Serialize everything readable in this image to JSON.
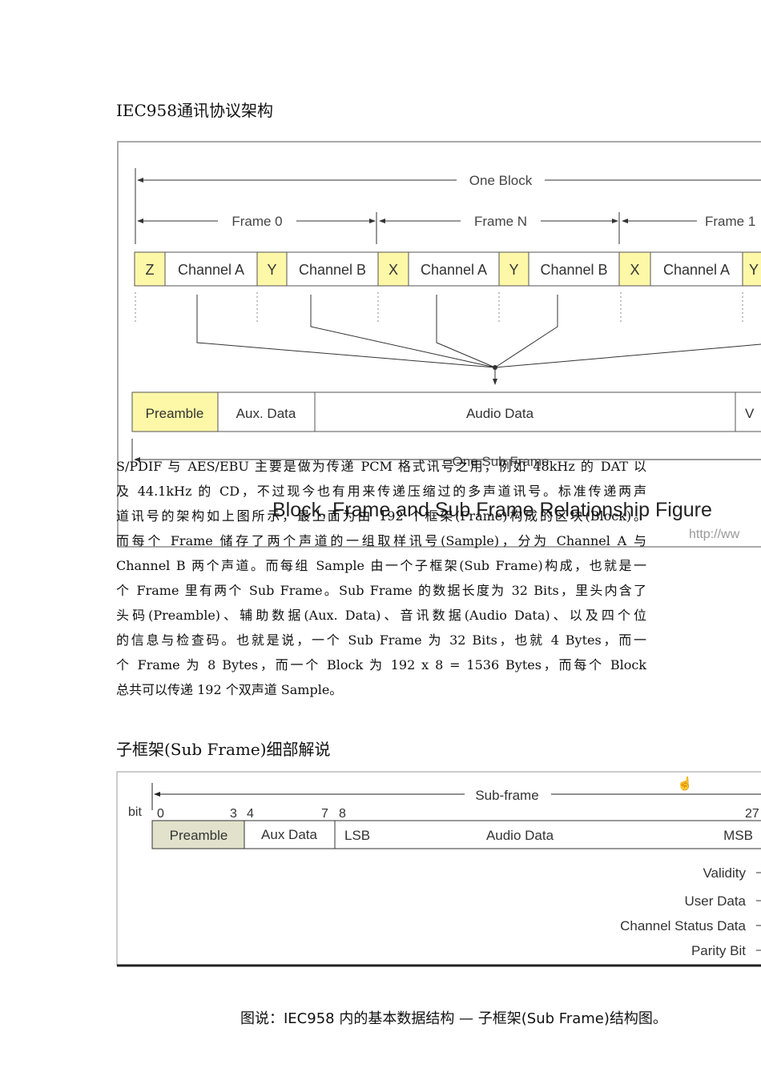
{
  "section1": {
    "heading": "IEC958通讯协议架构"
  },
  "figure1": {
    "one_block": "One Block",
    "frame_labels": [
      "Frame 0",
      "Frame N",
      "Frame 1"
    ],
    "cells": [
      "Z",
      "Channel A",
      "Y",
      "Channel B",
      "X",
      "Channel A",
      "Y",
      "Channel B",
      "X",
      "Channel A",
      "Y"
    ],
    "subframe_fields": [
      "Preamble",
      "Aux. Data",
      "Audio Data",
      "V"
    ],
    "one_sub_frame": "One Sub Frame",
    "title": "Block, Frame and Sub Frame Relationship Figure",
    "url": "http://ww",
    "highlight_color": "#fdf8a8"
  },
  "paragraph": {
    "lines": [
      "S/PDIF 与 AES/EBU 主要是做为传递 PCM 格式讯号之用，例如 48kHz 的 DAT 以",
      "及 44.1kHz 的 CD，不过现今也有用来传递压缩过的多声道讯号。标准传递两声",
      "道讯号的架构如上图所示，最上面为由 192 个框架(Frame)构成的区块(Block)。",
      "而每个 Frame 储存了两个声道的一组取样讯号(Sample)，分为 Channel A 与",
      "Channel B 两个声道。而每组 Sample 由一个子框架(Sub Frame)构成，也就是一",
      "个 Frame 里有两个 Sub Frame。Sub Frame 的数据长度为 32 Bits，里头内含了",
      "头码(Preamble)、辅助数据(Aux. Data)、音讯数据(Audio Data)、以及四个位",
      "的信息与检查码。也就是说，一个 Sub Frame 为 32 Bits，也就 4 Bytes，而一",
      "个 Frame 为 8 Bytes，而一个 Block 为 192 x 8 = 1536 Bytes，而每个 Block",
      "总共可以传递 192 个双声道 Sample。"
    ]
  },
  "section2": {
    "heading": "子框架(Sub Frame)细部解说"
  },
  "figure2": {
    "sub_frame": "Sub-frame",
    "bit_label": "bit",
    "bit_numbers": [
      "0",
      "3",
      "4",
      "7",
      "8",
      "27"
    ],
    "fields": [
      "Preamble",
      "Aux Data",
      "LSB",
      "Audio Data",
      "MSB"
    ],
    "flags": [
      "Validity",
      "User Data",
      "Channel Status Data",
      "Parity Bit"
    ],
    "preamble_color": "#e2e2cc"
  },
  "caption": "图说：IEC958 内的基本数据结构 — 子框架(Sub Frame)结构图。"
}
